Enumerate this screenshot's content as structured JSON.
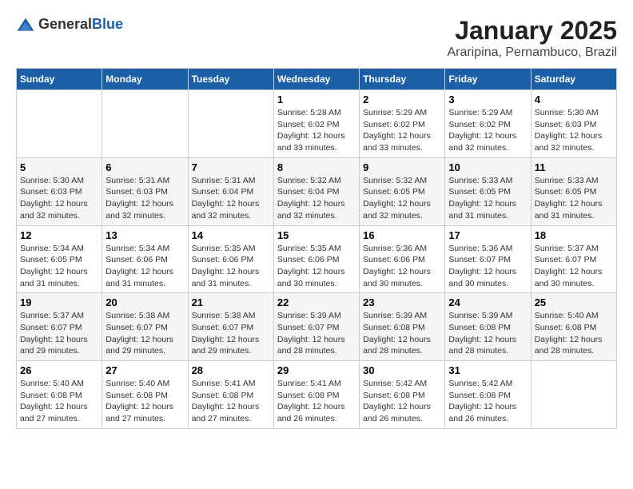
{
  "logo": {
    "general": "General",
    "blue": "Blue"
  },
  "title": "January 2025",
  "subtitle": "Araripina, Pernambuco, Brazil",
  "days_of_week": [
    "Sunday",
    "Monday",
    "Tuesday",
    "Wednesday",
    "Thursday",
    "Friday",
    "Saturday"
  ],
  "weeks": [
    [
      {
        "day": "",
        "info": ""
      },
      {
        "day": "",
        "info": ""
      },
      {
        "day": "",
        "info": ""
      },
      {
        "day": "1",
        "info": "Sunrise: 5:28 AM\nSunset: 6:02 PM\nDaylight: 12 hours and 33 minutes."
      },
      {
        "day": "2",
        "info": "Sunrise: 5:29 AM\nSunset: 6:02 PM\nDaylight: 12 hours and 33 minutes."
      },
      {
        "day": "3",
        "info": "Sunrise: 5:29 AM\nSunset: 6:02 PM\nDaylight: 12 hours and 32 minutes."
      },
      {
        "day": "4",
        "info": "Sunrise: 5:30 AM\nSunset: 6:03 PM\nDaylight: 12 hours and 32 minutes."
      }
    ],
    [
      {
        "day": "5",
        "info": "Sunrise: 5:30 AM\nSunset: 6:03 PM\nDaylight: 12 hours and 32 minutes."
      },
      {
        "day": "6",
        "info": "Sunrise: 5:31 AM\nSunset: 6:03 PM\nDaylight: 12 hours and 32 minutes."
      },
      {
        "day": "7",
        "info": "Sunrise: 5:31 AM\nSunset: 6:04 PM\nDaylight: 12 hours and 32 minutes."
      },
      {
        "day": "8",
        "info": "Sunrise: 5:32 AM\nSunset: 6:04 PM\nDaylight: 12 hours and 32 minutes."
      },
      {
        "day": "9",
        "info": "Sunrise: 5:32 AM\nSunset: 6:05 PM\nDaylight: 12 hours and 32 minutes."
      },
      {
        "day": "10",
        "info": "Sunrise: 5:33 AM\nSunset: 6:05 PM\nDaylight: 12 hours and 31 minutes."
      },
      {
        "day": "11",
        "info": "Sunrise: 5:33 AM\nSunset: 6:05 PM\nDaylight: 12 hours and 31 minutes."
      }
    ],
    [
      {
        "day": "12",
        "info": "Sunrise: 5:34 AM\nSunset: 6:05 PM\nDaylight: 12 hours and 31 minutes."
      },
      {
        "day": "13",
        "info": "Sunrise: 5:34 AM\nSunset: 6:06 PM\nDaylight: 12 hours and 31 minutes."
      },
      {
        "day": "14",
        "info": "Sunrise: 5:35 AM\nSunset: 6:06 PM\nDaylight: 12 hours and 31 minutes."
      },
      {
        "day": "15",
        "info": "Sunrise: 5:35 AM\nSunset: 6:06 PM\nDaylight: 12 hours and 30 minutes."
      },
      {
        "day": "16",
        "info": "Sunrise: 5:36 AM\nSunset: 6:06 PM\nDaylight: 12 hours and 30 minutes."
      },
      {
        "day": "17",
        "info": "Sunrise: 5:36 AM\nSunset: 6:07 PM\nDaylight: 12 hours and 30 minutes."
      },
      {
        "day": "18",
        "info": "Sunrise: 5:37 AM\nSunset: 6:07 PM\nDaylight: 12 hours and 30 minutes."
      }
    ],
    [
      {
        "day": "19",
        "info": "Sunrise: 5:37 AM\nSunset: 6:07 PM\nDaylight: 12 hours and 29 minutes."
      },
      {
        "day": "20",
        "info": "Sunrise: 5:38 AM\nSunset: 6:07 PM\nDaylight: 12 hours and 29 minutes."
      },
      {
        "day": "21",
        "info": "Sunrise: 5:38 AM\nSunset: 6:07 PM\nDaylight: 12 hours and 29 minutes."
      },
      {
        "day": "22",
        "info": "Sunrise: 5:39 AM\nSunset: 6:07 PM\nDaylight: 12 hours and 28 minutes."
      },
      {
        "day": "23",
        "info": "Sunrise: 5:39 AM\nSunset: 6:08 PM\nDaylight: 12 hours and 28 minutes."
      },
      {
        "day": "24",
        "info": "Sunrise: 5:39 AM\nSunset: 6:08 PM\nDaylight: 12 hours and 28 minutes."
      },
      {
        "day": "25",
        "info": "Sunrise: 5:40 AM\nSunset: 6:08 PM\nDaylight: 12 hours and 28 minutes."
      }
    ],
    [
      {
        "day": "26",
        "info": "Sunrise: 5:40 AM\nSunset: 6:08 PM\nDaylight: 12 hours and 27 minutes."
      },
      {
        "day": "27",
        "info": "Sunrise: 5:40 AM\nSunset: 6:08 PM\nDaylight: 12 hours and 27 minutes."
      },
      {
        "day": "28",
        "info": "Sunrise: 5:41 AM\nSunset: 6:08 PM\nDaylight: 12 hours and 27 minutes."
      },
      {
        "day": "29",
        "info": "Sunrise: 5:41 AM\nSunset: 6:08 PM\nDaylight: 12 hours and 26 minutes."
      },
      {
        "day": "30",
        "info": "Sunrise: 5:42 AM\nSunset: 6:08 PM\nDaylight: 12 hours and 26 minutes."
      },
      {
        "day": "31",
        "info": "Sunrise: 5:42 AM\nSunset: 6:08 PM\nDaylight: 12 hours and 26 minutes."
      },
      {
        "day": "",
        "info": ""
      }
    ]
  ]
}
